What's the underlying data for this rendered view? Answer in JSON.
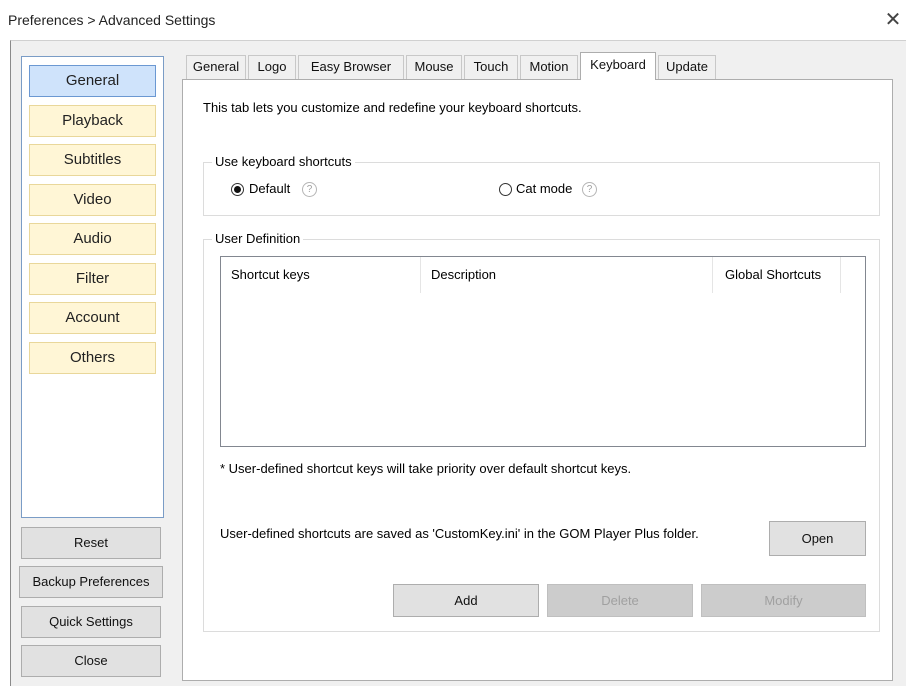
{
  "window": {
    "title": "Preferences > Advanced Settings",
    "close_glyph": "✕"
  },
  "categories": [
    {
      "label": "General",
      "selected": true
    },
    {
      "label": "Playback"
    },
    {
      "label": "Subtitles"
    },
    {
      "label": "Video"
    },
    {
      "label": "Audio"
    },
    {
      "label": "Filter"
    },
    {
      "label": "Account"
    },
    {
      "label": "Others"
    }
  ],
  "side_buttons": {
    "reset": "Reset",
    "backup": "Backup Preferences",
    "quick": "Quick Settings",
    "close": "Close"
  },
  "tabs": [
    {
      "label": "General"
    },
    {
      "label": "Logo"
    },
    {
      "label": "Easy Browser"
    },
    {
      "label": "Mouse"
    },
    {
      "label": "Touch"
    },
    {
      "label": "Motion"
    },
    {
      "label": "Keyboard",
      "active": true
    },
    {
      "label": "Update"
    }
  ],
  "keyboard": {
    "intro": "This tab lets you customize and redefine your keyboard shortcuts.",
    "use_shortcuts": {
      "legend": "Use keyboard shortcuts",
      "options": [
        {
          "label": "Default",
          "checked": true,
          "help": "?"
        },
        {
          "label": "Cat mode",
          "checked": false,
          "help": "?"
        }
      ]
    },
    "user_definition": {
      "legend": "User Definition",
      "columns": [
        "Shortcut keys",
        "Description",
        "Global Shortcuts"
      ],
      "rows": [],
      "note": "* User-defined shortcut keys will take priority over default shortcut keys.",
      "saved_info": "User-defined shortcuts are saved as 'CustomKey.ini' in the GOM Player Plus folder.",
      "open_label": "Open",
      "add_label": "Add",
      "delete_label": "Delete",
      "modify_label": "Modify"
    }
  }
}
